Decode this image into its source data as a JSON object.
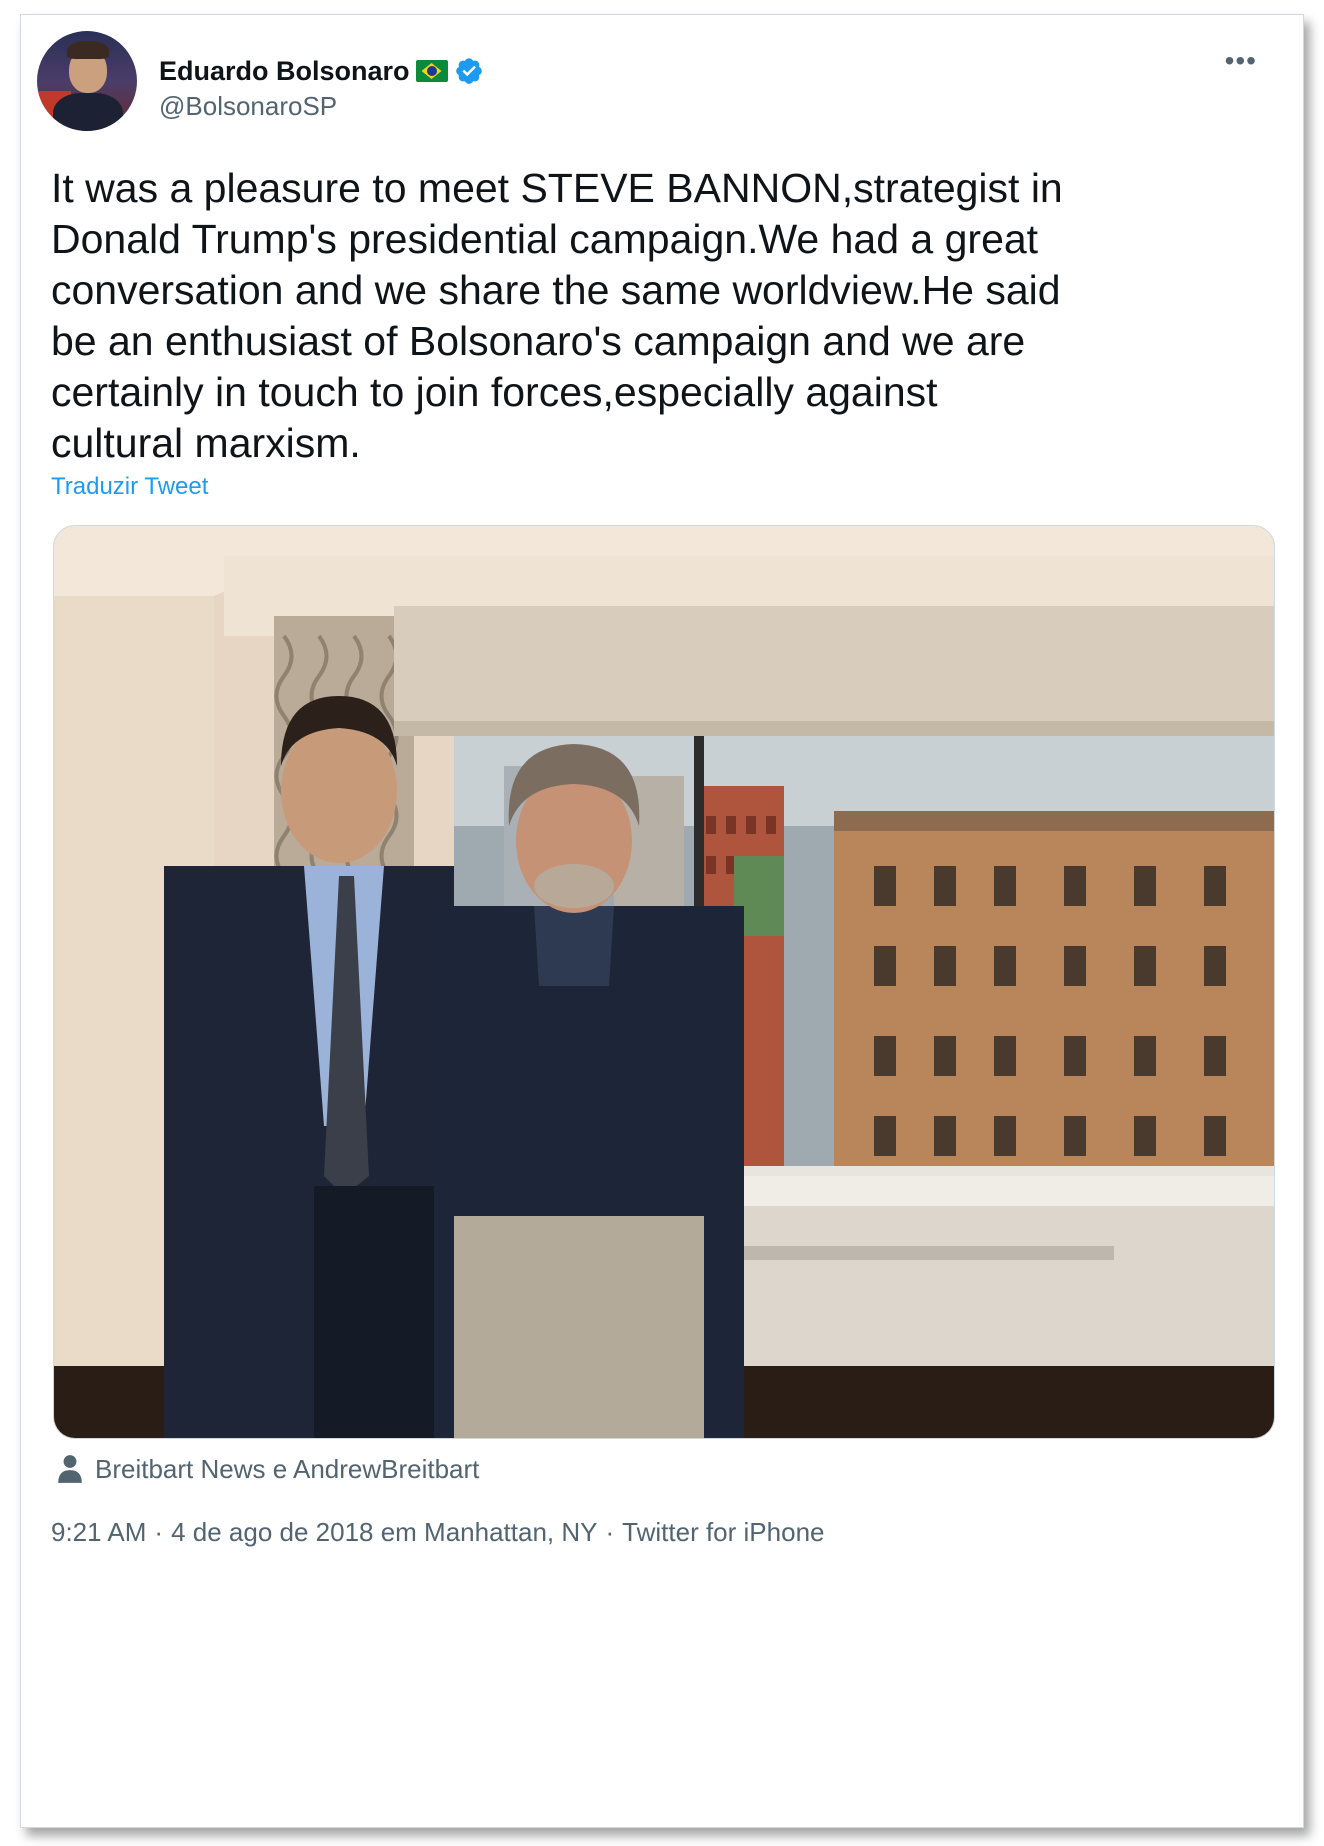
{
  "author": {
    "name": "Eduardo Bolsonaro",
    "handle": "@BolsonaroSP",
    "flag_icon": "brazil-flag-icon",
    "verified_icon": "verified-badge-icon"
  },
  "menu": {
    "more_label": "•••"
  },
  "tweet": {
    "text": "It was a pleasure to meet STEVE BANNON,strategist in\nDonald Trump's presidential campaign.We had a great\nconversation and we share the same worldview.He said\nbe an enthusiast of Bolsonaro's campaign and we are\ncertainly in touch to join forces,especially against\ncultural marxism.",
    "translate_label": "Traduzir Tweet"
  },
  "media": {
    "tagged": "Breitbart News e AndrewBreitbart"
  },
  "meta": {
    "time": "9:21 AM",
    "sep1": "·",
    "date_location": "4 de ago de 2018 em Manhattan, NY",
    "sep2": "·",
    "source": "Twitter for iPhone"
  },
  "colors": {
    "accent": "#1d9bf0",
    "text_primary": "#0f1419",
    "text_secondary": "#536471"
  }
}
